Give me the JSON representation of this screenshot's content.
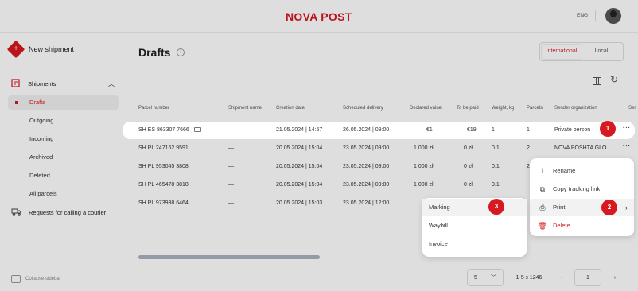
{
  "header": {
    "logo": "NOVA POST",
    "lang": "ENG"
  },
  "sidebar": {
    "new_shipment": "New shipment",
    "shipments": "Shipments",
    "items": [
      {
        "label": "Drafts",
        "active": true
      },
      {
        "label": "Outgoing"
      },
      {
        "label": "Incoming"
      },
      {
        "label": "Archived"
      },
      {
        "label": "Deleted"
      },
      {
        "label": "All parcels"
      }
    ],
    "requests": "Requests for calling a courier",
    "collapse": "Collapse sidebar"
  },
  "main": {
    "title": "Drafts",
    "info_icon": "i",
    "toggle": {
      "international": "International",
      "local": "Local"
    },
    "columns": [
      "Parcel number",
      "Shipment name",
      "Creation date",
      "Scheduled delivery",
      "Declared value",
      "To be paid",
      "Weight, kg",
      "Parcels",
      "Sender organization",
      "Ser"
    ],
    "rows": [
      {
        "parcel": "SH ES 863307 7666",
        "name": "—",
        "created": "21.05.2024 | 14:57",
        "delivery": "26.05.2024 | 09:00",
        "declared": "€1",
        "paid": "€19",
        "weight": "1",
        "parcels": "1",
        "sender": "Private person",
        "highlight": true
      },
      {
        "parcel": "SH PL 247162 9591",
        "name": "—",
        "created": "20.05.2024 | 15:04",
        "delivery": "23.05.2024 | 09:00",
        "declared": "1 000 zł",
        "paid": "0 zł",
        "weight": "0.1",
        "parcels": "2",
        "sender": "NOVA POSHTA GLO..."
      },
      {
        "parcel": "SH PL 953045 3808",
        "name": "—",
        "created": "20.05.2024 | 15:04",
        "delivery": "23.05.2024 | 09:00",
        "declared": "1 000 zł",
        "paid": "0 zł",
        "weight": "0.1",
        "parcels": "2",
        "sender": ""
      },
      {
        "parcel": "SH PL 465478 3818",
        "name": "—",
        "created": "20.05.2024 | 15:04",
        "delivery": "23.05.2024 | 09:00",
        "declared": "1 000 zł",
        "paid": "0 zł",
        "weight": "0.1",
        "parcels": "",
        "sender": ""
      },
      {
        "parcel": "SH PL 973938 6464",
        "name": "—",
        "created": "20.05.2024 | 15:03",
        "delivery": "23.05.2024 | 12:00",
        "declared": "",
        "paid": "",
        "weight": "",
        "parcels": "",
        "sender": ""
      }
    ],
    "more": "···"
  },
  "context_menu": {
    "items": [
      {
        "label": "Rename",
        "icon": "cursor-icon"
      },
      {
        "label": "Copy tracking link",
        "icon": "copy-link-icon"
      },
      {
        "label": "Print",
        "icon": "printer-icon",
        "submenu": true
      },
      {
        "label": "Delete",
        "icon": "trash-icon",
        "danger": true
      }
    ]
  },
  "print_submenu": {
    "items": [
      "Marking",
      "Waybill",
      "Invoice"
    ]
  },
  "pagination": {
    "per_page": "5",
    "range": "1-5 з 1246",
    "page": "1"
  },
  "badges": [
    "1",
    "2",
    "3"
  ],
  "colors": {
    "accent": "#d71920"
  }
}
